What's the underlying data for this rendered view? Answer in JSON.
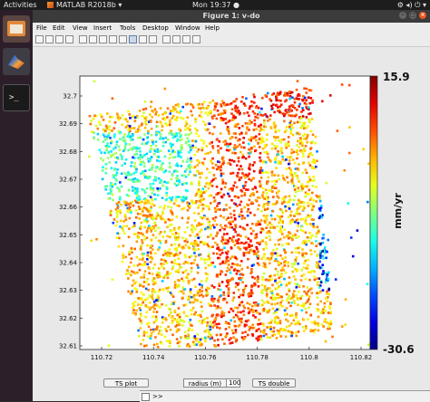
{
  "topbar": {
    "activities": "Activities",
    "app": "MATLAB R2018b ▾",
    "clock": "Mon 19:37 ●",
    "tray": "⚙ ◂) ⏻ ▾"
  },
  "window": {
    "title": "Figure 1: v-do",
    "controls": [
      "–",
      "□",
      "×"
    ]
  },
  "menu": [
    "File",
    "Edit",
    "View",
    "Insert",
    "Tools",
    "Desktop",
    "Window",
    "Help"
  ],
  "toolbar_icons": [
    "new-figure-icon",
    "open-icon",
    "save-icon",
    "print-icon",
    "select-arrow-icon",
    "zoom-in-icon",
    "zoom-out-icon",
    "pan-icon",
    "rotate-icon",
    "data-cursor-icon",
    "brush-icon",
    "link-icon",
    "colorbar-icon",
    "legend-icon",
    "hide-plot-tools-icon",
    "show-plot-tools-icon"
  ],
  "chart_data": {
    "type": "heatmap",
    "title": "",
    "xlabel": "",
    "ylabel": "",
    "x_ticks": [
      "110.72",
      "110.74",
      "110.76",
      "110.78",
      "110.8",
      "110.82"
    ],
    "y_ticks": [
      "32.7",
      "32.69",
      "32.68",
      "32.67",
      "32.66",
      "32.65",
      "32.64",
      "32.63",
      "32.62",
      "32.61"
    ],
    "xlim": [
      110.708,
      110.828
    ],
    "ylim": [
      32.606,
      32.712
    ],
    "colorbar": {
      "max": "15.9",
      "min": "-30.6",
      "label": "mm/yr",
      "colormap": "jet"
    },
    "background": "#ffffff",
    "note_axis_orientation": "y ticks increase downward as shown"
  },
  "controls": {
    "ts_plot": "TS plot",
    "radius_label": "radius (m)",
    "radius_value": "100",
    "ts_double": "TS double d..."
  },
  "cmd_prompt": ">>"
}
